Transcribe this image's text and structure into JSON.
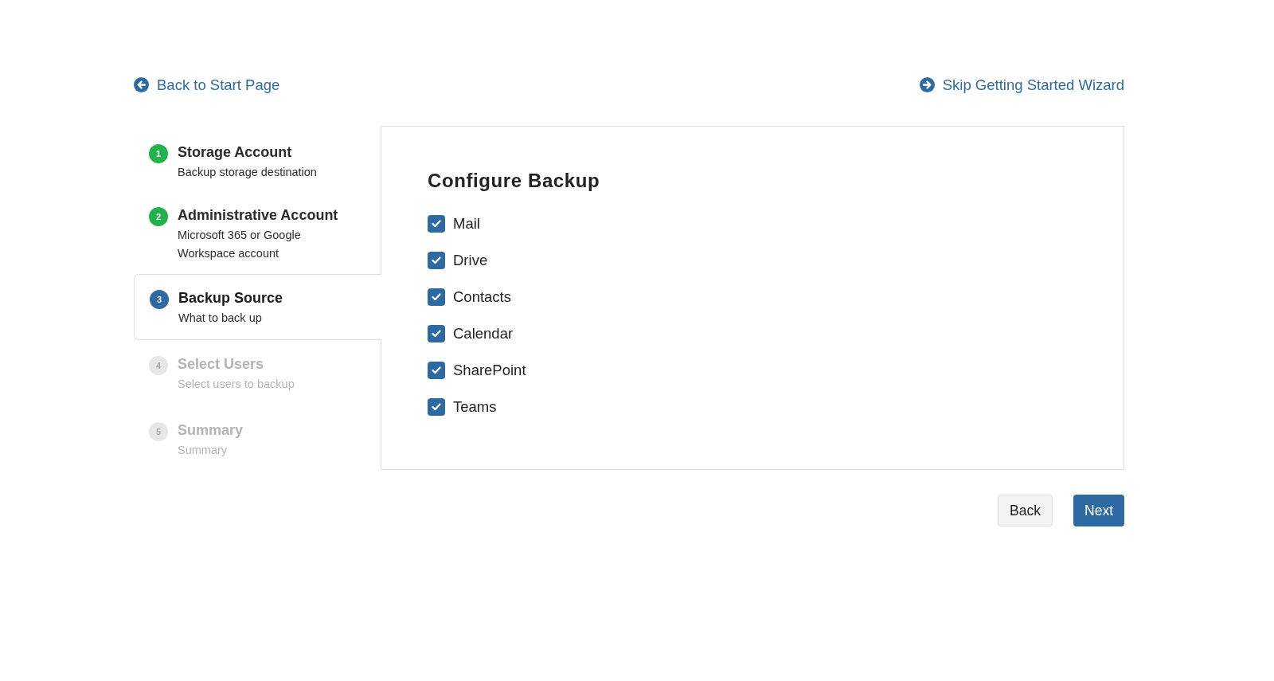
{
  "top_links": {
    "back": "Back to Start Page",
    "skip": "Skip Getting Started Wizard"
  },
  "steps": [
    {
      "number": "1",
      "title": "Storage Account",
      "subtitle": "Backup storage destination",
      "kind": "done",
      "selected": false
    },
    {
      "number": "2",
      "title": "Administrative Account",
      "subtitle": "Microsoft 365 or Google Workspace account",
      "kind": "done",
      "selected": false
    },
    {
      "number": "3",
      "title": "Backup Source",
      "subtitle": "What to back up",
      "kind": "current",
      "selected": true
    },
    {
      "number": "4",
      "title": "Select Users",
      "subtitle": "Select users to backup",
      "kind": "pending",
      "selected": false
    },
    {
      "number": "5",
      "title": "Summary",
      "subtitle": "Summary",
      "kind": "pending",
      "selected": false
    }
  ],
  "panel": {
    "title": "Configure Backup",
    "options": [
      {
        "label": "Mail",
        "checked": true
      },
      {
        "label": "Drive",
        "checked": true
      },
      {
        "label": "Contacts",
        "checked": true
      },
      {
        "label": "Calendar",
        "checked": true
      },
      {
        "label": "SharePoint",
        "checked": true
      },
      {
        "label": "Teams",
        "checked": true
      }
    ]
  },
  "buttons": {
    "back": "Back",
    "next": "Next"
  }
}
